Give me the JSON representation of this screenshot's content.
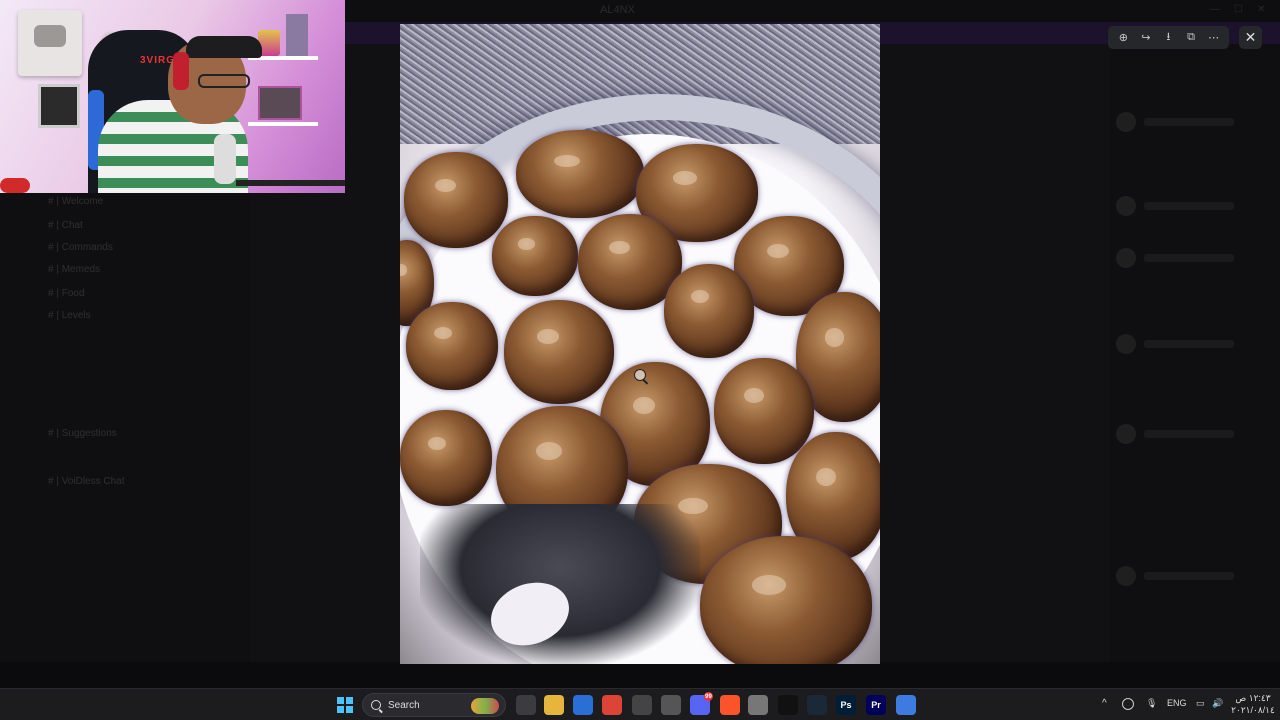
{
  "background_app": {
    "title": "AL4NX",
    "channels": [
      "# | Welcome",
      "# | Chat",
      "# | Commands",
      "# | Memeds",
      "# | Food",
      "# | Levels",
      "# | Suggestions",
      "# | VoiDless Chat"
    ]
  },
  "webcam": {
    "chair_brand": "3VIRGN"
  },
  "viewer": {
    "toolbar": [
      {
        "name": "zoom-in-icon",
        "glyph": "⊕"
      },
      {
        "name": "share-icon",
        "glyph": "↪"
      },
      {
        "name": "download-icon",
        "glyph": "⭳"
      },
      {
        "name": "open-external-icon",
        "glyph": "⧉"
      },
      {
        "name": "more-icon",
        "glyph": "⋯"
      }
    ],
    "close_glyph": "✕"
  },
  "taskbar": {
    "search_label": "Search",
    "language": "ENG",
    "time": "١٢:٤٣ ص",
    "date": "٢٠٢١/٠٨/١٤",
    "apps": [
      {
        "name": "task-view-icon",
        "label": "",
        "color": "#3b3b40"
      },
      {
        "name": "file-explorer-icon",
        "label": "",
        "color": "#e6b53b"
      },
      {
        "name": "microsoft-store-icon",
        "label": "",
        "color": "#2a6fd6"
      },
      {
        "name": "chrome-icon",
        "label": "",
        "color": "#db4437"
      },
      {
        "name": "obs-icon",
        "label": "",
        "color": "#444"
      },
      {
        "name": "settings-icon",
        "label": "",
        "color": "#555"
      },
      {
        "name": "discord-icon",
        "label": "",
        "color": "#5865f2",
        "badge": "99"
      },
      {
        "name": "brave-icon",
        "label": "",
        "color": "#fb542b"
      },
      {
        "name": "notes-icon",
        "label": "",
        "color": "#777"
      },
      {
        "name": "capcut-icon",
        "label": "",
        "color": "#111"
      },
      {
        "name": "steam-icon",
        "label": "",
        "color": "#1b2838"
      },
      {
        "name": "photoshop-icon",
        "label": "Ps",
        "color": "#001e36"
      },
      {
        "name": "premiere-icon",
        "label": "Pr",
        "color": "#00005b"
      },
      {
        "name": "app-icon",
        "label": "",
        "color": "#3d7be0"
      }
    ]
  }
}
